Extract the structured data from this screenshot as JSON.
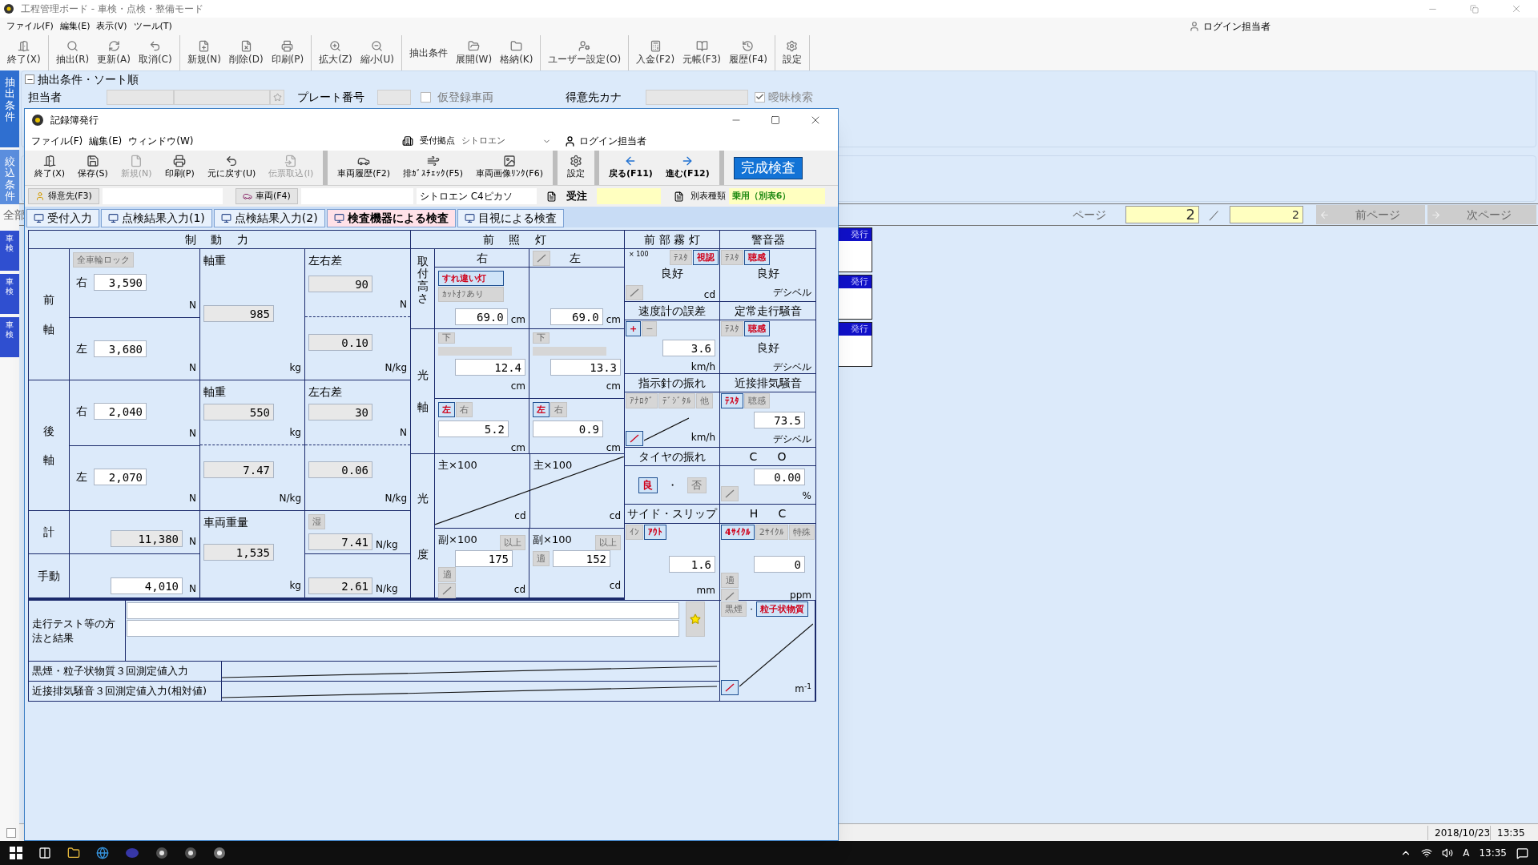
{
  "app": {
    "title": "工程管理ボード - 車検・点検・整備モード",
    "menu": [
      "ファイル(F)",
      "編集(E)",
      "表示(V)",
      "ツール(T)"
    ],
    "login": "ログイン担当者",
    "toolbar": [
      [
        {
          "label": "終了(X)",
          "kind": "icon"
        }
      ],
      [
        {
          "label": "抽出(R)",
          "kind": "icon"
        },
        {
          "label": "更新(A)",
          "kind": "icon"
        },
        {
          "label": "取消(C)",
          "kind": "icon"
        }
      ],
      [
        {
          "label": "新規(N)",
          "kind": "icon"
        },
        {
          "label": "削除(D)",
          "kind": "icon"
        },
        {
          "label": "印刷(P)",
          "kind": "icon"
        }
      ],
      [
        {
          "label": "拡大(Z)",
          "kind": "icon"
        },
        {
          "label": "縮小(U)",
          "kind": "icon"
        }
      ],
      [
        {
          "label": "抽出条件",
          "kind": "text"
        },
        {
          "label": "展開(W)",
          "kind": "icon"
        },
        {
          "label": "格納(K)",
          "kind": "icon"
        }
      ],
      [
        {
          "label": "ユーザー設定(O)",
          "kind": "icon"
        }
      ],
      [
        {
          "label": "入金(F2)",
          "kind": "icon"
        },
        {
          "label": "元帳(F3)",
          "kind": "icon"
        },
        {
          "label": "履歴(F4)",
          "kind": "icon"
        }
      ],
      [
        {
          "label": "設定",
          "kind": "icon"
        }
      ]
    ],
    "side_tabs": [
      {
        "label": "抽出条件",
        "selected": true
      },
      {
        "label": "絞込条件",
        "selected": false
      }
    ],
    "doc_tabs": [
      "車検",
      "車検",
      "車検"
    ]
  },
  "filter": {
    "title": "抽出条件・ソート順",
    "staff": "担当者",
    "plate": "プレート番号",
    "temp": {
      "label": "仮登録車両",
      "checked": false
    },
    "kana": "得意先カナ",
    "fuzzy": {
      "label": "曖昧検索",
      "checked": true
    }
  },
  "page": {
    "all": "全部",
    "label": "ページ",
    "current": "2",
    "sep": "／",
    "total": "2",
    "prev": "前ページ",
    "next": "次ページ"
  },
  "cards": [
    "発行",
    "発行",
    "発行"
  ],
  "status": {
    "checked": false,
    "date": "2018/10/23",
    "time": "13:35"
  },
  "taskbar": {
    "ime": "A",
    "time": "13:35"
  },
  "dialog": {
    "title": "記録簿発行",
    "menu": [
      "ファイル(F)",
      "編集(E)",
      "ウィンドウ(W)"
    ],
    "base_label": "受付拠点",
    "base_value": "シトロエン",
    "login": "ログイン担当者",
    "toolbar": [
      [
        {
          "label": "終了(X)",
          "kind": "tool",
          "disabled": false
        },
        {
          "label": "保存(S)",
          "kind": "tool",
          "disabled": false
        },
        {
          "label": "新規(N)",
          "kind": "tool",
          "disabled": true
        },
        {
          "label": "印刷(P)",
          "kind": "tool",
          "disabled": false
        },
        {
          "label": "元に戻す(U)",
          "kind": "tool",
          "disabled": false
        },
        {
          "label": "伝票取込(I)",
          "kind": "tool",
          "disabled": true
        }
      ],
      [
        {
          "label": "車両履歴(F2)",
          "kind": "tool",
          "disabled": false
        },
        {
          "label": "排ｶﾞｽﾁｪｯｸ(F5)",
          "kind": "tool",
          "disabled": false
        },
        {
          "label": "車両画像ﾘﾝｸ(F6)",
          "kind": "tool",
          "disabled": false
        }
      ],
      [
        {
          "label": "設定",
          "kind": "tool",
          "disabled": false
        }
      ],
      [
        {
          "label": "戻る(F11)",
          "kind": "nav",
          "disabled": false
        },
        {
          "label": "進む(F12)",
          "kind": "nav",
          "disabled": false
        }
      ]
    ],
    "complete": "完成検査",
    "info": {
      "customer": "得意先(F3)",
      "vehicle": "車両(F4)",
      "model": "シトロエン C4ピカソ",
      "order": "受注",
      "type_label": "別表種類",
      "type_value": "乗用（別表6）"
    },
    "tabs": [
      {
        "label": "受付入力",
        "selected": false
      },
      {
        "label": "点検結果入力(1)",
        "selected": false
      },
      {
        "label": "点検結果入力(2)",
        "selected": false
      },
      {
        "label": "検査機器による検査",
        "selected": true
      },
      {
        "label": "目視による検査",
        "selected": false
      }
    ]
  },
  "form": {
    "brake": {
      "title": "制 動 力",
      "lock": {
        "label": "全車輪ロック",
        "selected": false
      },
      "front": {
        "label": "前軸",
        "right_label": "右",
        "right": {
          "v": "3,590",
          "u": "N"
        },
        "left_label": "左",
        "left": {
          "v": "3,680",
          "u": "N"
        },
        "axle_label": "軸重",
        "axle": {
          "v": "985",
          "u": "kg"
        },
        "diff_label": "左右差",
        "diff": {
          "v": "90",
          "u": "N"
        },
        "ratio": {
          "v": "0.10",
          "u": "N/kg"
        }
      },
      "rear": {
        "label": "後軸",
        "right_label": "右",
        "right": {
          "v": "2,040",
          "u": "N"
        },
        "left_label": "左",
        "left": {
          "v": "2,070",
          "u": "N"
        },
        "axle_label": "軸重",
        "axle": {
          "v": "550",
          "u": "kg"
        },
        "axle_ratio": {
          "v": "7.47",
          "u": "N/kg"
        },
        "diff_label": "左右差",
        "diff": {
          "v": "30",
          "u": "N"
        },
        "ratio": {
          "v": "0.06",
          "u": "N/kg"
        }
      },
      "total": {
        "label": "計",
        "value": {
          "v": "11,380",
          "u": "N"
        },
        "weight_label": "車両重量",
        "weight": {
          "v": "1,535",
          "u": "kg"
        },
        "wet": {
          "label": "湿",
          "selected": false
        },
        "ratio": {
          "v": "7.41",
          "u": "N/kg"
        }
      },
      "parking": {
        "label": "手動",
        "value": {
          "v": "4,010",
          "u": "N"
        },
        "ratio": {
          "v": "2.61",
          "u": "N/kg"
        }
      }
    },
    "headlight": {
      "title": "前 照 灯",
      "right_label": "右",
      "left_label": "左",
      "left_slash": false,
      "mount": {
        "label": "取付高さ",
        "passing": {
          "label": "すれ違い灯",
          "selected": true
        },
        "cutoff": {
          "label": "ｶｯﾄｵﾌあり",
          "selected": false
        },
        "right": {
          "v": "69.0",
          "u": "cm"
        },
        "left": {
          "v": "69.0",
          "u": "cm"
        }
      },
      "axis": {
        "label": "光軸",
        "right_down": {
          "label": "下",
          "selected": false
        },
        "left_down": {
          "label": "下",
          "selected": false
        },
        "right_v": {
          "v": "12.4",
          "u": "cm"
        },
        "left_v": {
          "v": "13.3",
          "u": "cm"
        },
        "right_dir": [
          {
            "label": "左",
            "selected": true
          },
          {
            "label": "右",
            "selected": false
          }
        ],
        "left_dir": [
          {
            "label": "左",
            "selected": true
          },
          {
            "label": "右",
            "selected": false
          }
        ],
        "right_h": {
          "v": "5.2",
          "u": "cm"
        },
        "left_h": {
          "v": "0.9",
          "u": "cm"
        }
      },
      "intensity": {
        "label": "光度",
        "main_right": {
          "label": "主×100",
          "u": "cd"
        },
        "main_left": {
          "label": "主×100",
          "u": "cd"
        },
        "sub_right": {
          "label": "副×100",
          "above": {
            "label": "以上",
            "selected": false
          },
          "ok": {
            "label": "適",
            "selected": false
          },
          "slash": false,
          "v": "175",
          "u": "cd"
        },
        "sub_left": {
          "label": "副×100",
          "above": {
            "label": "以上",
            "selected": false
          },
          "ok": {
            "label": "適",
            "selected": false
          },
          "v": "152",
          "u": "cd"
        }
      }
    },
    "fog": {
      "title": "前 部 霧 灯",
      "scale": "× 100",
      "buttons": [
        {
          "label": "ﾃｽﾀ",
          "selected": false
        },
        {
          "label": "視認",
          "selected": true
        }
      ],
      "slash": false,
      "result": "良好",
      "u": "cd"
    },
    "horn": {
      "title": "警音器",
      "buttons": [
        {
          "label": "ﾃｽﾀ",
          "selected": false
        },
        {
          "label": "聴感",
          "selected": true
        }
      ],
      "result": "良好",
      "u": "デシベル"
    },
    "speedometer": {
      "title": "速度計の誤差",
      "buttons": [
        {
          "label": "+",
          "selected": true
        },
        {
          "label": "−",
          "selected": false
        }
      ],
      "v": "3.6",
      "u": "km/h"
    },
    "steady_noise": {
      "title": "定常走行騒音",
      "buttons": [
        {
          "label": "ﾃｽﾀ",
          "selected": false
        },
        {
          "label": "聴感",
          "selected": true
        }
      ],
      "result": "良好",
      "u": "デシベル"
    },
    "needle": {
      "title": "指示針の振れ",
      "buttons": [
        {
          "label": "ｱﾅﾛｸﾞ",
          "selected": false
        },
        {
          "label": "ﾃﾞｼﾞﾀﾙ",
          "selected": false
        },
        {
          "label": "他",
          "selected": false
        }
      ],
      "slash": true,
      "u": "km/h"
    },
    "exhaust_noise": {
      "title": "近接排気騒音",
      "buttons": [
        {
          "label": "ﾃｽﾀ",
          "selected": true
        },
        {
          "label": "聴感",
          "selected": false
        }
      ],
      "v": "73.5",
      "u": "デシベル"
    },
    "tire": {
      "title": "タイヤの振れ",
      "buttons": [
        {
          "label": "良",
          "selected": true
        },
        {
          "label": "否",
          "selected": false
        }
      ],
      "sep": "・"
    },
    "co": {
      "labels": [
        "C",
        "O"
      ],
      "slash": false,
      "v": "0.00",
      "u": "%"
    },
    "side_slip": {
      "title": "サイド・スリップ",
      "buttons": [
        {
          "label": "ｲﾝ",
          "selected": false
        },
        {
          "label": "ｱｳﾄ",
          "selected": true
        }
      ],
      "v": "1.6",
      "u": "mm"
    },
    "hc": {
      "labels": [
        "H",
        "C"
      ],
      "buttons": [
        {
          "label": "4ｻｲｸﾙ",
          "selected": true
        },
        {
          "label": "2ｻｲｸﾙ",
          "selected": false
        },
        {
          "label": "特殊",
          "selected": false
        }
      ],
      "ok": {
        "label": "適",
        "selected": false
      },
      "slash": false,
      "v": "0",
      "u": "ppm"
    },
    "driving_test": {
      "label": "走行テスト等の方法と結果"
    },
    "smoke": {
      "buttons": [
        {
          "label": "黒煙",
          "selected": false
        },
        {
          "label": "粒子状物質",
          "selected": true
        }
      ],
      "sep": "・",
      "slash": true,
      "u": "m$^{-1}$"
    },
    "measure_rows": [
      "黒煙・粒子状物質３回測定値入力",
      "近接排気騒音３回測定値入力(相対値)"
    ]
  }
}
